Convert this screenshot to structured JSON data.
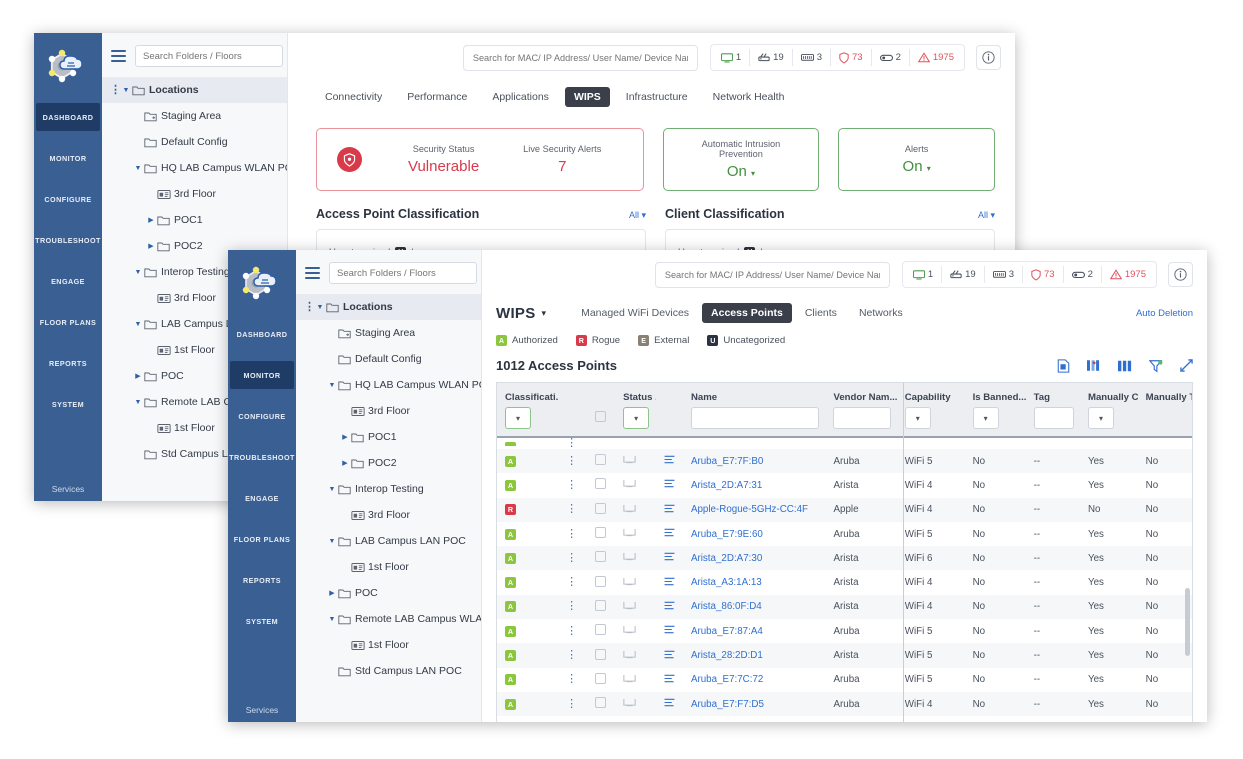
{
  "colors": {
    "rail_bg": "#3a5f93",
    "rail_active": "#1f3c66",
    "accent_link": "#2f6fd0",
    "danger": "#d93a4a",
    "success": "#42903f",
    "authorized": "#8cc63f",
    "rogue": "#d93a4a",
    "external": "#8a8073",
    "uncategorized": "#2c3340"
  },
  "rail": {
    "logo_name": "network-cloud-logo",
    "items": [
      {
        "label": "DASHBOARD",
        "active_back": true,
        "active_front": false
      },
      {
        "label": "MONITOR",
        "active_back": false,
        "active_front": true
      },
      {
        "label": "CONFIGURE",
        "active_back": false,
        "active_front": false
      },
      {
        "label": "TROUBLESHOOT",
        "active_back": false,
        "active_front": false
      },
      {
        "label": "ENGAGE",
        "active_back": false,
        "active_front": false
      },
      {
        "label": "FLOOR PLANS",
        "active_back": false,
        "active_front": false
      },
      {
        "label": "REPORTS",
        "active_back": false,
        "active_front": false
      },
      {
        "label": "SYSTEM",
        "active_back": false,
        "active_front": false
      }
    ],
    "services_label": "Services"
  },
  "tree": {
    "search_placeholder": "Search Folders / Floors",
    "nodes": [
      {
        "label": "Locations",
        "indent": 0,
        "type": "folder",
        "twisty": "down",
        "root": true,
        "kebab": true
      },
      {
        "label": "Staging Area",
        "indent": 1,
        "type": "staging",
        "twisty": "",
        "root": false,
        "kebab": false
      },
      {
        "label": "Default Config",
        "indent": 1,
        "type": "folder",
        "twisty": "",
        "root": false,
        "kebab": false
      },
      {
        "label": "HQ LAB Campus WLAN PO",
        "indent": 1,
        "type": "folder",
        "twisty": "down",
        "root": false,
        "kebab": false
      },
      {
        "label": "3rd Floor",
        "indent": 2,
        "type": "floor",
        "twisty": "",
        "root": false,
        "kebab": false
      },
      {
        "label": "POC1",
        "indent": 2,
        "type": "folder",
        "twisty": "right",
        "root": false,
        "kebab": false
      },
      {
        "label": "POC2",
        "indent": 2,
        "type": "folder",
        "twisty": "right",
        "root": false,
        "kebab": false
      },
      {
        "label": "Interop Testing",
        "indent": 1,
        "type": "folder",
        "twisty": "down",
        "root": false,
        "kebab": false
      },
      {
        "label": "3rd Floor",
        "indent": 2,
        "type": "floor",
        "twisty": "",
        "root": false,
        "kebab": false
      },
      {
        "label": "LAB Campus LAN POC",
        "indent": 1,
        "type": "folder",
        "twisty": "down",
        "root": false,
        "kebab": false
      },
      {
        "label": "1st Floor",
        "indent": 2,
        "type": "floor",
        "twisty": "",
        "root": false,
        "kebab": false
      },
      {
        "label": "POC",
        "indent": 1,
        "type": "folder",
        "twisty": "right",
        "root": false,
        "kebab": false
      },
      {
        "label": "Remote LAB Campus WLA",
        "indent": 1,
        "type": "folder",
        "twisty": "down",
        "root": false,
        "kebab": false
      },
      {
        "label": "1st Floor",
        "indent": 2,
        "type": "floor",
        "twisty": "",
        "root": false,
        "kebab": false
      },
      {
        "label": "Std Campus LAN POC",
        "indent": 1,
        "type": "folder",
        "twisty": "",
        "root": false,
        "kebab": false
      }
    ]
  },
  "topbar": {
    "search_placeholder": "Search for MAC/ IP Address/ User Name/ Device Name...",
    "chips": [
      {
        "icon": "monitor-icon",
        "value": "1",
        "tone": "green"
      },
      {
        "icon": "server-icon",
        "value": "19",
        "tone": "dark"
      },
      {
        "icon": "switch-icon",
        "value": "3",
        "tone": "dark"
      },
      {
        "icon": "shield-icon",
        "value": "73",
        "tone": "red"
      },
      {
        "icon": "capsule-icon",
        "value": "2",
        "tone": "dark"
      },
      {
        "icon": "warning-icon",
        "value": "1975",
        "tone": "red"
      }
    ],
    "info_icon": "info-icon"
  },
  "back_window": {
    "tabs": [
      {
        "label": "Connectivity",
        "active": false
      },
      {
        "label": "Performance",
        "active": false
      },
      {
        "label": "Applications",
        "active": false
      },
      {
        "label": "WIPS",
        "active": true
      },
      {
        "label": "Infrastructure",
        "active": false
      },
      {
        "label": "Network Health",
        "active": false
      }
    ],
    "cards": {
      "security_status_label": "Security Status",
      "security_status_value": "Vulnerable",
      "live_alerts_label": "Live Security Alerts",
      "live_alerts_value": "7",
      "aip_label": "Automatic Intrusion Prevention",
      "aip_value": "On",
      "alerts_label": "Alerts",
      "alerts_value": "On"
    },
    "sections": [
      {
        "title": "Access Point Classification",
        "filter": "All",
        "box_label": "Uncategorized",
        "box_badge": "U"
      },
      {
        "title": "Client Classification",
        "filter": "All",
        "box_label": "Uncategorized",
        "box_badge": "U"
      }
    ]
  },
  "front_window": {
    "module_title": "WIPS",
    "tabs": [
      {
        "label": "Managed WiFi Devices",
        "active": false
      },
      {
        "label": "Access Points",
        "active": true
      },
      {
        "label": "Clients",
        "active": false
      },
      {
        "label": "Networks",
        "active": false
      }
    ],
    "auto_deletion_label": "Auto Deletion",
    "legend": [
      {
        "badge": "A",
        "label": "Authorized",
        "color": "#8cc63f"
      },
      {
        "badge": "R",
        "label": "Rogue",
        "color": "#d93a4a"
      },
      {
        "badge": "E",
        "label": "External",
        "color": "#8a8073"
      },
      {
        "badge": "U",
        "label": "Uncategorized",
        "color": "#2c3340"
      }
    ],
    "count_title": "1012 Access Points",
    "tools": [
      {
        "name": "export-report-icon"
      },
      {
        "name": "chart-columns-icon"
      },
      {
        "name": "columns-icon"
      },
      {
        "name": "filter-icon"
      },
      {
        "name": "expand-icon"
      }
    ],
    "table": {
      "columns": [
        {
          "label": "Classificati...",
          "filter": "select-green",
          "width": "9%"
        },
        {
          "label": "",
          "filter": "none",
          "width": "4.2%"
        },
        {
          "label": "",
          "filter": "checkbox",
          "width": "4.2%"
        },
        {
          "label": "Status ...",
          "filter": "select-green",
          "width": "6%"
        },
        {
          "label": "",
          "filter": "none",
          "width": "4%"
        },
        {
          "label": "Name",
          "filter": "text",
          "width": "21%"
        },
        {
          "label": "Vendor Nam...",
          "filter": "text",
          "width": "10.5%"
        },
        {
          "label": "Capability",
          "filter": "select",
          "width": "10%"
        },
        {
          "label": "Is Banned...",
          "filter": "select",
          "width": "9%"
        },
        {
          "label": "Tag",
          "filter": "text",
          "width": "8%"
        },
        {
          "label": "Manually Cla...",
          "filter": "select",
          "width": "8.5%"
        },
        {
          "label": "Manually Ta...",
          "filter": "none",
          "width": "8%"
        }
      ],
      "rows": [
        {
          "cls": "A",
          "name": "Aruba_E7:7F:B0",
          "vendor": "Aruba",
          "capability": "WiFi 5",
          "banned": "No",
          "tag": "--",
          "manual_cls": "Yes",
          "manual_tag": "No"
        },
        {
          "cls": "A",
          "name": "Arista_2D:A7:31",
          "vendor": "Arista",
          "capability": "WiFi 4",
          "banned": "No",
          "tag": "--",
          "manual_cls": "Yes",
          "manual_tag": "No"
        },
        {
          "cls": "R",
          "name": "Apple-Rogue-5GHz-CC:4F",
          "vendor": "Apple",
          "capability": "WiFi 4",
          "banned": "No",
          "tag": "--",
          "manual_cls": "No",
          "manual_tag": "No"
        },
        {
          "cls": "A",
          "name": "Aruba_E7:9E:60",
          "vendor": "Aruba",
          "capability": "WiFi 5",
          "banned": "No",
          "tag": "--",
          "manual_cls": "Yes",
          "manual_tag": "No"
        },
        {
          "cls": "A",
          "name": "Arista_2D:A7:30",
          "vendor": "Arista",
          "capability": "WiFi 6",
          "banned": "No",
          "tag": "--",
          "manual_cls": "Yes",
          "manual_tag": "No"
        },
        {
          "cls": "A",
          "name": "Arista_A3:1A:13",
          "vendor": "Arista",
          "capability": "WiFi 4",
          "banned": "No",
          "tag": "--",
          "manual_cls": "Yes",
          "manual_tag": "No"
        },
        {
          "cls": "A",
          "name": "Arista_86:0F:D4",
          "vendor": "Arista",
          "capability": "WiFi 4",
          "banned": "No",
          "tag": "--",
          "manual_cls": "Yes",
          "manual_tag": "No"
        },
        {
          "cls": "A",
          "name": "Aruba_E7:87:A4",
          "vendor": "Aruba",
          "capability": "WiFi 5",
          "banned": "No",
          "tag": "--",
          "manual_cls": "Yes",
          "manual_tag": "No"
        },
        {
          "cls": "A",
          "name": "Arista_28:2D:D1",
          "vendor": "Arista",
          "capability": "WiFi 5",
          "banned": "No",
          "tag": "--",
          "manual_cls": "Yes",
          "manual_tag": "No"
        },
        {
          "cls": "A",
          "name": "Aruba_E7:7C:72",
          "vendor": "Aruba",
          "capability": "WiFi 5",
          "banned": "No",
          "tag": "--",
          "manual_cls": "Yes",
          "manual_tag": "No"
        },
        {
          "cls": "A",
          "name": "Aruba_E7:F7:D5",
          "vendor": "Aruba",
          "capability": "WiFi 4",
          "banned": "No",
          "tag": "--",
          "manual_cls": "Yes",
          "manual_tag": "No"
        }
      ]
    }
  }
}
